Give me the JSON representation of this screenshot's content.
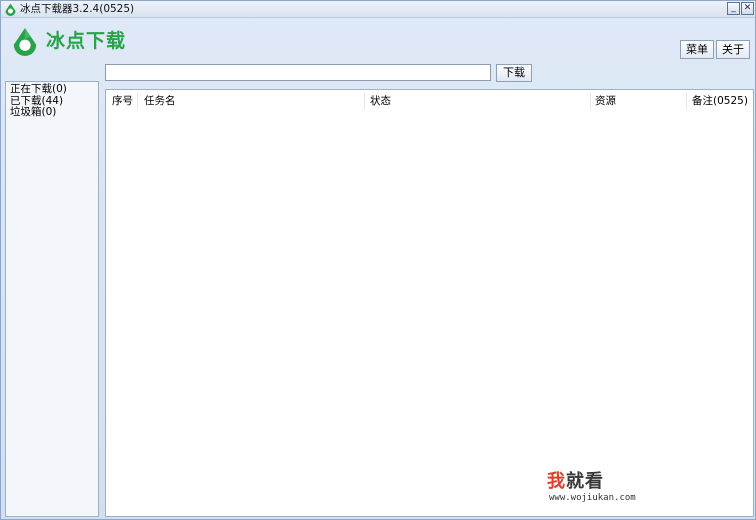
{
  "window": {
    "title": "冰点下载器3.2.4(0525)",
    "min_glyph": "_",
    "close_glyph": "✕"
  },
  "brand": {
    "name": "冰点下载",
    "color": "#27a34a"
  },
  "toolbar": {
    "menu_label": "菜单",
    "about_label": "关于",
    "url_value": "",
    "download_label": "下载"
  },
  "sidebar": {
    "items": [
      {
        "label": "正在下载(0)"
      },
      {
        "label": "已下载(44)"
      },
      {
        "label": "垃圾箱(0)"
      }
    ]
  },
  "table": {
    "columns": [
      "序号",
      "任务名",
      "状态",
      "资源",
      "备注(0525)"
    ],
    "rows": []
  },
  "watermark": {
    "char_highlight": "我",
    "chars_rest": "就看",
    "url": "www.wojiukan.com"
  }
}
